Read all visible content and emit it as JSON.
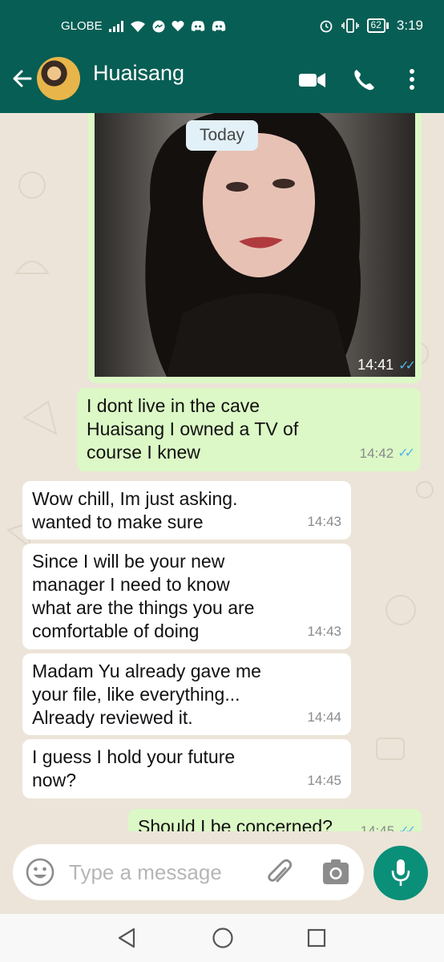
{
  "status_bar": {
    "carrier": "GLOBE",
    "battery": "62",
    "time": "3:19"
  },
  "header": {
    "contact_name": "Huaisang"
  },
  "chat": {
    "date_label": "Today",
    "image_message": {
      "time": "14:41"
    },
    "messages": [
      {
        "direction": "out",
        "text": "I dont live in the cave\nHuaisang I owned a TV of\ncourse I knew",
        "time": "14:42"
      },
      {
        "direction": "in",
        "text": "Wow chill, Im just asking.\nwanted to make sure",
        "time": "14:43"
      },
      {
        "direction": "in",
        "text": "Since I will be your new\nmanager I need to know\nwhat are the things you are\ncomfortable of doing",
        "time": "14:43"
      },
      {
        "direction": "in",
        "text": "Madam Yu already gave me\nyour file, like everything...\nAlready reviewed it.",
        "time": "14:44"
      },
      {
        "direction": "in",
        "text": "I guess I hold your future\nnow?",
        "time": "14:45"
      },
      {
        "direction": "out",
        "text": "Should I be concerned?",
        "time": "14:45"
      }
    ]
  },
  "composer": {
    "placeholder": "Type a message"
  },
  "colors": {
    "header": "#075e54",
    "outgoing_bubble": "#dcf8c6",
    "incoming_bubble": "#ffffff",
    "mic_button": "#0a8f79",
    "read_ticks": "#4fb6ec"
  }
}
